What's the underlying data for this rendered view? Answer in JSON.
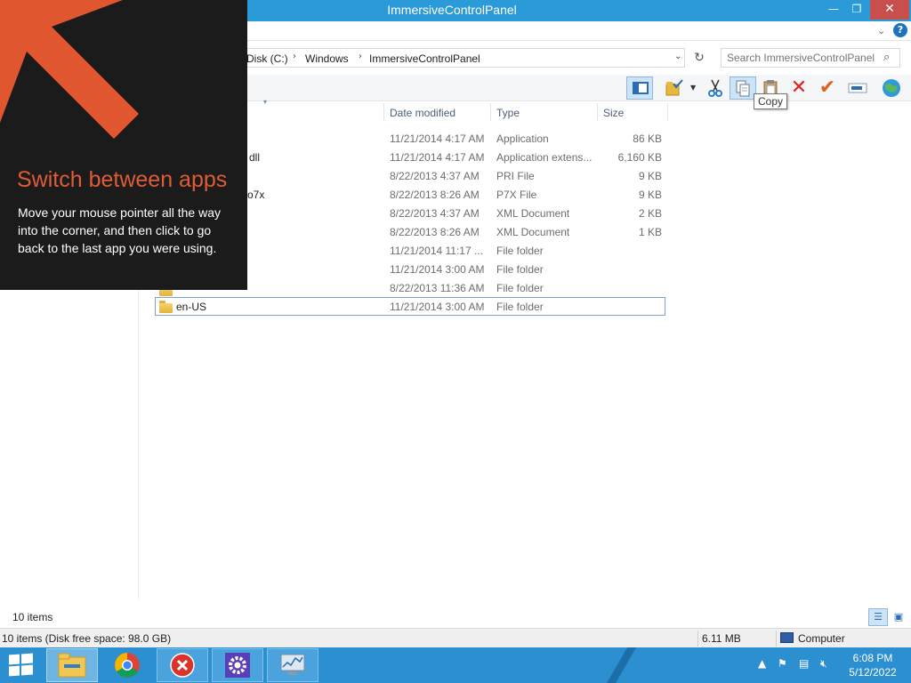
{
  "window": {
    "title": "ImmersiveControlPanel",
    "close_label": "✕",
    "min_label": "—",
    "max_label": "❐"
  },
  "ribbon": {
    "chevron": "⌄",
    "help": "?"
  },
  "address": {
    "crumbs": [
      "Disk (C:)",
      "Windows",
      "ImmersiveControlPanel"
    ],
    "separator": "›",
    "dropdown": "⌄",
    "refresh": "↻"
  },
  "search": {
    "placeholder": "Search ImmersiveControlPanel",
    "icon": "⌕"
  },
  "toolbar": {
    "tooltip": "Copy"
  },
  "columns": {
    "date": "Date modified",
    "type": "Type",
    "size": "Size"
  },
  "files": [
    {
      "name": "",
      "date": "11/21/2014 4:17 AM",
      "type": "Application",
      "size": "86 KB"
    },
    {
      "name": "dll",
      "date": "11/21/2014 4:17 AM",
      "type": "Application extens...",
      "size": "6,160 KB"
    },
    {
      "name": "",
      "date": "8/22/2013 4:37 AM",
      "type": "PRI File",
      "size": "9 KB"
    },
    {
      "name": "o7x",
      "date": "8/22/2013 8:26 AM",
      "type": "P7X File",
      "size": "9 KB"
    },
    {
      "name": "",
      "date": "8/22/2013 4:37 AM",
      "type": "XML Document",
      "size": "2 KB"
    },
    {
      "name": "",
      "date": "8/22/2013 8:26 AM",
      "type": "XML Document",
      "size": "1 KB"
    },
    {
      "name": "",
      "date": "11/21/2014 11:17 ...",
      "type": "File folder",
      "size": ""
    },
    {
      "name": "",
      "date": "11/21/2014 3:00 AM",
      "type": "File folder",
      "size": ""
    },
    {
      "name": "",
      "date": "8/22/2013 11:36 AM",
      "type": "File folder",
      "size": ""
    },
    {
      "name": "en-US",
      "date": "11/21/2014 3:00 AM",
      "type": "File folder",
      "size": ""
    }
  ],
  "footer": {
    "item_count": "10 items"
  },
  "status": {
    "left": "10 items (Disk free space: 98.0 GB)",
    "size": "6.11 MB",
    "location": "Computer"
  },
  "charm": {
    "title": "Switch between apps",
    "body": "Move your mouse pointer all the way into the corner, and then click to go back to the last app you were using."
  },
  "clock": {
    "time": "6:08 PM",
    "date": "5/12/2022"
  },
  "colors": {
    "accent": "#2b9ad8",
    "taskbar": "#2b8fd0",
    "charm_title": "#e05c36",
    "charm_arrow": "#e0562f"
  }
}
